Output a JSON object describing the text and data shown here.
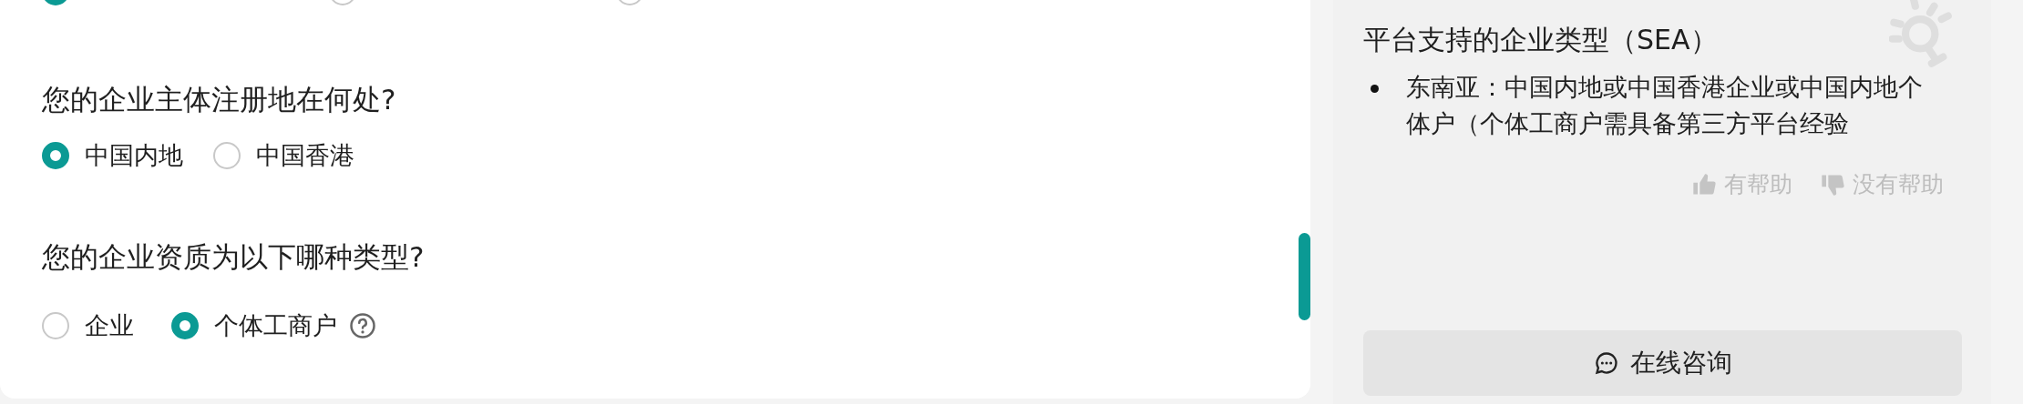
{
  "top_options": [
    {
      "selected": true
    },
    {
      "selected": false
    },
    {
      "selected": false
    }
  ],
  "questions": [
    {
      "title": "您的企业主体注册地在何处?",
      "options": [
        {
          "label": "中国内地",
          "selected": true,
          "help": false
        },
        {
          "label": "中国香港",
          "selected": false,
          "help": false
        }
      ]
    },
    {
      "title": "您的企业资质为以下哪种类型?",
      "options": [
        {
          "label": "企业",
          "selected": false,
          "help": false
        },
        {
          "label": "个体工商户",
          "selected": true,
          "help": true
        }
      ]
    }
  ],
  "tip": {
    "title": "平台支持的企业类型（SEA）",
    "items": [
      "东南亚：中国内地或中国香港企业或中国内地个体户（个体工商户需具备第三方平台经验"
    ],
    "feedback": [
      "有帮助",
      "没有帮助"
    ],
    "button": "在线咨询"
  }
}
